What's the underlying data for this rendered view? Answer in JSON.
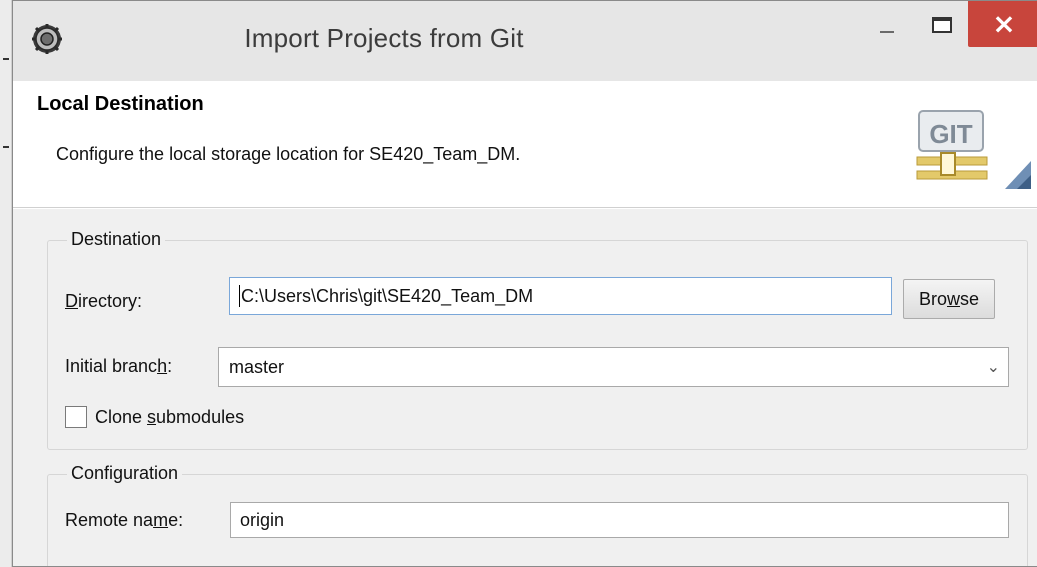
{
  "window": {
    "title": "Import Projects from Git",
    "close_glyph": "×",
    "icons": {
      "app": "eclipse-gear-icon",
      "minimize": "minimize-icon",
      "maximize": "maximize-icon",
      "close": "close-icon"
    },
    "colors": {
      "close_button": "#c8453c",
      "titlebar": "#e6e6e6",
      "body": "#f0f0f0"
    }
  },
  "header": {
    "title": "Local Destination",
    "description": "Configure the local storage location for SE420_Team_DM.",
    "logo_text": "GIT"
  },
  "destination": {
    "group_label": "Destination",
    "directory_label_ul": "D",
    "directory_label_rest": "irectory:",
    "directory_value": "C:\\Users\\Chris\\git\\SE420_Team_DM",
    "browse_pre": "Bro",
    "browse_ul": "w",
    "browse_post": "se",
    "branch_label_pre": "Initial branc",
    "branch_label_ul": "h",
    "branch_label_post": ":",
    "branch_value": "master",
    "branch_chevron": "⌄",
    "clone_submodules_checked": false,
    "clone_label_pre": "Clone ",
    "clone_label_ul": "s",
    "clone_label_post": "ubmodules"
  },
  "configuration": {
    "group_label": "Configuration",
    "remote_label_pre": "Remote na",
    "remote_label_ul": "m",
    "remote_label_post": "e:",
    "remote_value": "origin"
  }
}
